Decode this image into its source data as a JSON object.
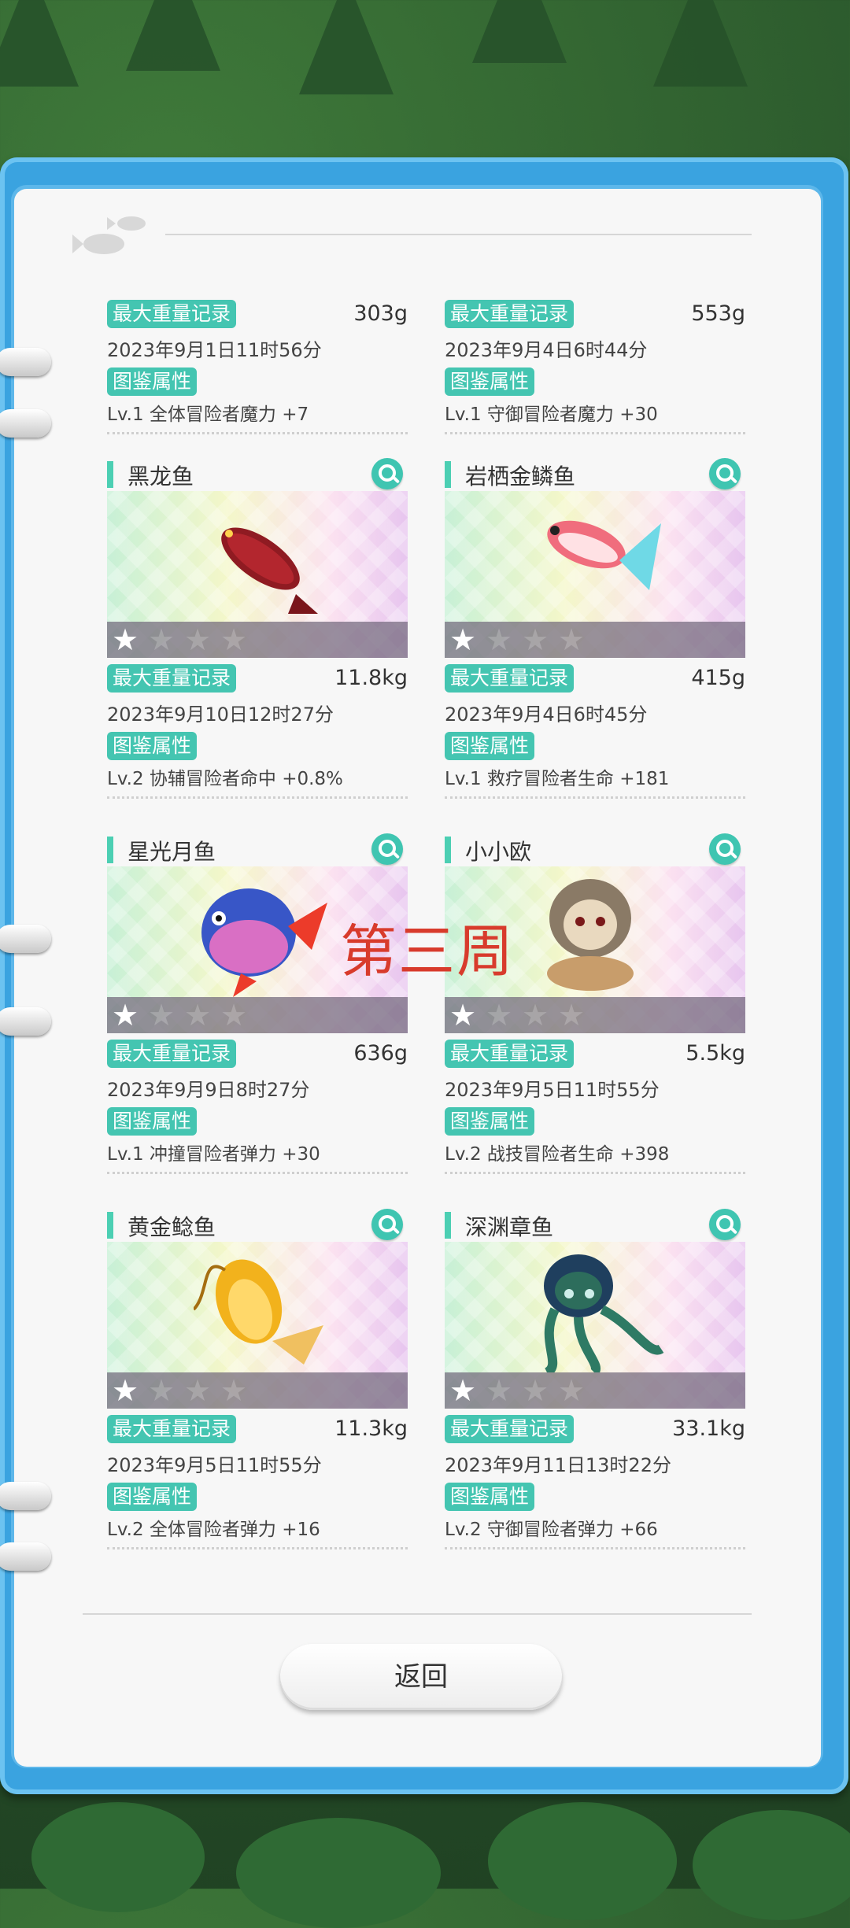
{
  "header_tabs": {
    "left_label": "",
    "right_label": ""
  },
  "watermark": "第三周",
  "back_button": "返回",
  "cards": [
    {
      "name": "",
      "record_label": "最大重量记录",
      "record": "303g",
      "date": "2023年9月1日11时56分",
      "attr_label": "图鉴属性",
      "attr": "Lv.1 全体冒险者魔力 +7",
      "stars": 0
    },
    {
      "name": "",
      "record_label": "最大重量记录",
      "record": "553g",
      "date": "2023年9月4日6时44分",
      "attr_label": "图鉴属性",
      "attr": "Lv.1 守御冒险者魔力 +30",
      "stars": 0
    },
    {
      "name": "黑龙鱼",
      "record_label": "最大重量记录",
      "record": "11.8kg",
      "date": "2023年9月10日12时27分",
      "attr_label": "图鉴属性",
      "attr": "Lv.2 协辅冒险者命中 +0.8%",
      "stars": 1,
      "fish": "red-arowana"
    },
    {
      "name": "岩栖金鳞鱼",
      "record_label": "最大重量记录",
      "record": "415g",
      "date": "2023年9月4日6时45分",
      "attr_label": "图鉴属性",
      "attr": "Lv.1 救疗冒险者生命 +181",
      "stars": 1,
      "fish": "squirrelfish"
    },
    {
      "name": "星光月鱼",
      "record_label": "最大重量记录",
      "record": "636g",
      "date": "2023年9月9日8时27分",
      "attr_label": "图鉴属性",
      "attr": "Lv.1 冲撞冒险者弹力 +30",
      "stars": 1,
      "fish": "opah"
    },
    {
      "name": "小小欧",
      "record_label": "最大重量记录",
      "record": "5.5kg",
      "date": "2023年9月5日11时55分",
      "attr_label": "图鉴属性",
      "attr": "Lv.2 战技冒险者生命 +398",
      "stars": 1,
      "fish": "hooded-creature"
    },
    {
      "name": "黄金鲶鱼",
      "record_label": "最大重量记录",
      "record": "11.3kg",
      "date": "2023年9月5日11时55分",
      "attr_label": "图鉴属性",
      "attr": "Lv.2 全体冒险者弹力 +16",
      "stars": 1,
      "fish": "golden-catfish"
    },
    {
      "name": "深渊章鱼",
      "record_label": "最大重量记录",
      "record": "33.1kg",
      "date": "2023年9月11日13时22分",
      "attr_label": "图鉴属性",
      "attr": "Lv.2 守御冒险者弹力 +66",
      "stars": 1,
      "fish": "octopus"
    }
  ],
  "colors": {
    "accent": "#44c5b1",
    "frame": "#3aa3e0",
    "watermark": "#d83b2c"
  }
}
